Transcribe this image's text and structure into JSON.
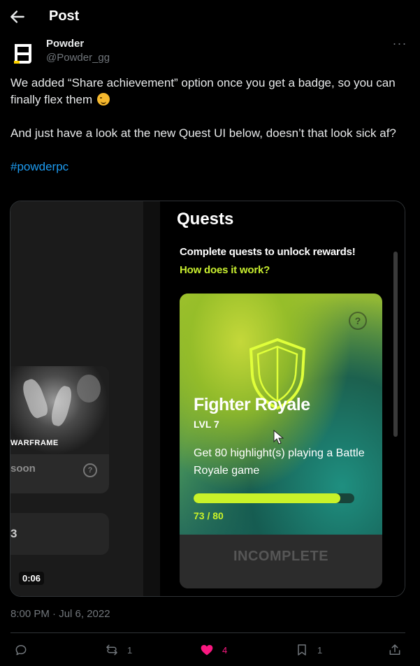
{
  "header": {
    "title": "Post",
    "back_icon": "arrow-left-icon"
  },
  "author": {
    "name": "Powder",
    "handle": "@Powder_gg",
    "avatar_icon": "powder-logo-icon"
  },
  "tweet": {
    "text_p1": "We added “Share achievement” option once you get a badge, so you can finally flex them",
    "emoji": "winking-face-emoji",
    "text_p2": "And just have a look at the new Quest UI below, doesn’t that look sick af?",
    "hashtag": "#powderpc",
    "timestamp": "8:00 PM · Jul 6, 2022"
  },
  "media": {
    "video_time": "0:06",
    "left_panel": {
      "game_logo": "WARFRAME",
      "card_status": "soon",
      "card_help": "?",
      "second_card_digit": "3"
    },
    "quests": {
      "title": "Quests",
      "subtitle": "Complete quests to unlock rewards!",
      "link": "How does it work?",
      "card": {
        "help": "?",
        "name": "Fighter Royale",
        "level": "LVL 7",
        "description": "Get 80 highlight(s) playing a Battle Royale game",
        "progress_current": 73,
        "progress_total": 80,
        "progress_text": "73 / 80",
        "status": "INCOMPLETE",
        "accent": "#c9f229"
      }
    }
  },
  "actions": {
    "reply_count": "",
    "retweet_count": "1",
    "like_count": "4",
    "bookmark_count": "1",
    "like_color": "#f91880"
  }
}
